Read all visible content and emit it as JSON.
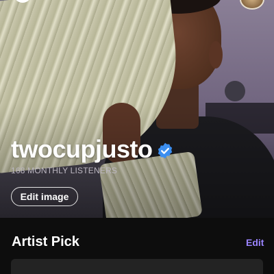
{
  "artist": {
    "name": "twocupjusto",
    "verified": true,
    "monthly_listeners": "168 MONTHLY LISTENERS",
    "edit_image_label": "Edit image"
  },
  "artist_pick": {
    "title": "Artist Pick",
    "edit_label": "Edit"
  },
  "icons": {
    "verified": "verified-badge-icon"
  },
  "colors": {
    "accent": "#9b84ff",
    "verified_badge": "#3b8ef0",
    "background": "#0d0d0d"
  }
}
